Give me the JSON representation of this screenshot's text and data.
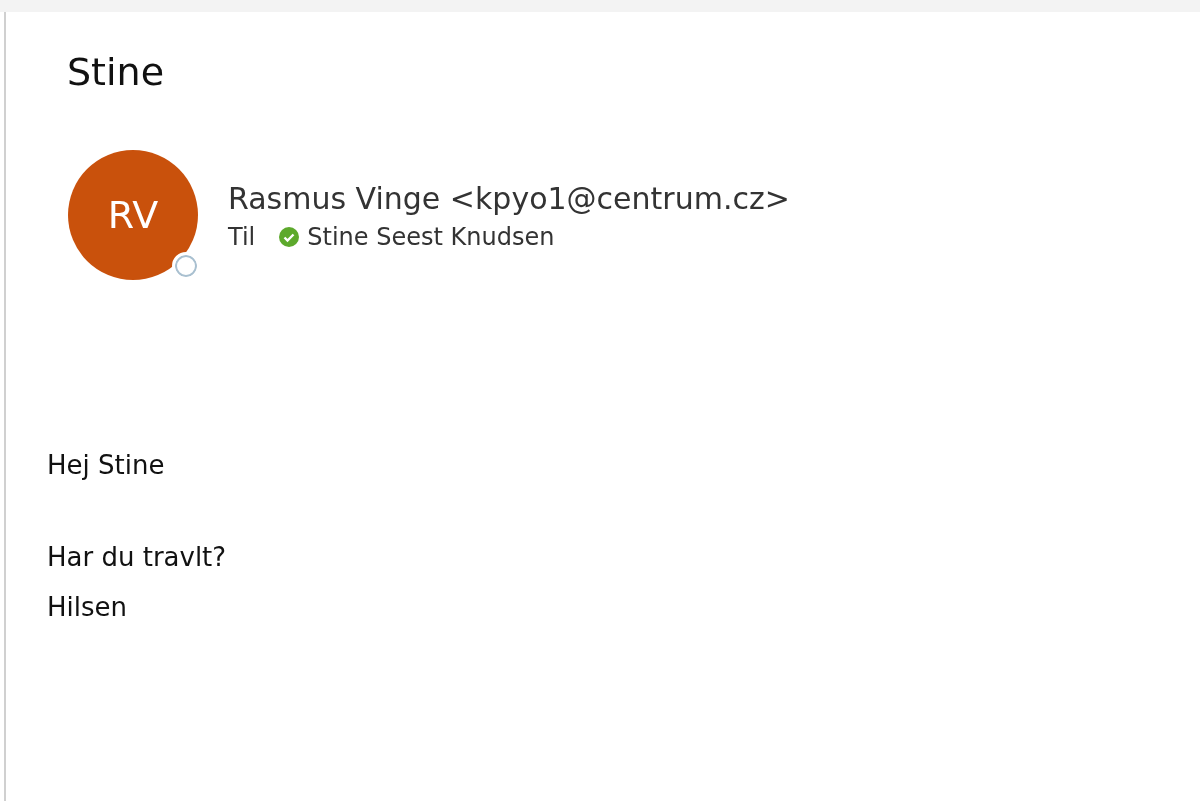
{
  "subject": "Stine",
  "sender": {
    "initials": "RV",
    "name": "Rasmus Vinge <kpyo1@centrum.cz>"
  },
  "recipients": {
    "label": "Til",
    "names": [
      "Stine Seest Knudsen"
    ]
  },
  "body": {
    "paragraphs": [
      [
        "Hej Stine"
      ],
      [
        "Har du travlt?",
        "Hilsen"
      ]
    ]
  }
}
